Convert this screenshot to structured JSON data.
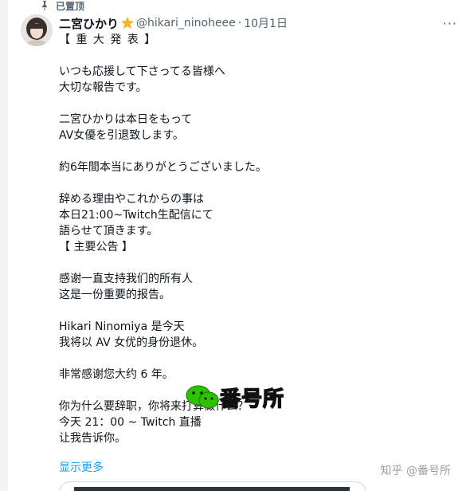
{
  "pinned_label": "已置顶",
  "author": {
    "name": "二宮ひかり",
    "handle": "@hikari_ninoheee",
    "date": "10月1日"
  },
  "tweet_lines": [
    "【 重 大 発 表 】",
    "",
    "いつも応援して下さってる皆様へ",
    "大切な報告です。",
    "",
    "二宮ひかりは本日をもって",
    "AV女優を引退致します。",
    "",
    "約6年間本当にありがとうございました。",
    "",
    "辞める理由やこれからの事は",
    "本日21:00~Twitch生配信にて",
    "語らせて頂きます。",
    "【 主要公告 】",
    "",
    "感谢一直支持我们的所有人",
    "这是一份重要的报告。",
    "",
    "Hikari Ninomiya 是今天",
    "我将以 AV 女优的身份退休。",
    "",
    "非常感谢您大约 6 年。",
    "",
    "你为什么要辞职，你将来打算做什么？",
    "今天 21：00 ~ Twitch 直播",
    "让我告诉你。"
  ],
  "show_more": "显示更多",
  "watermark": {
    "site": "番号所",
    "zhihu": "知乎 @番号所"
  },
  "colors": {
    "link": "#1d9bf0",
    "muted": "#536471",
    "verified": "#f5b32f"
  }
}
